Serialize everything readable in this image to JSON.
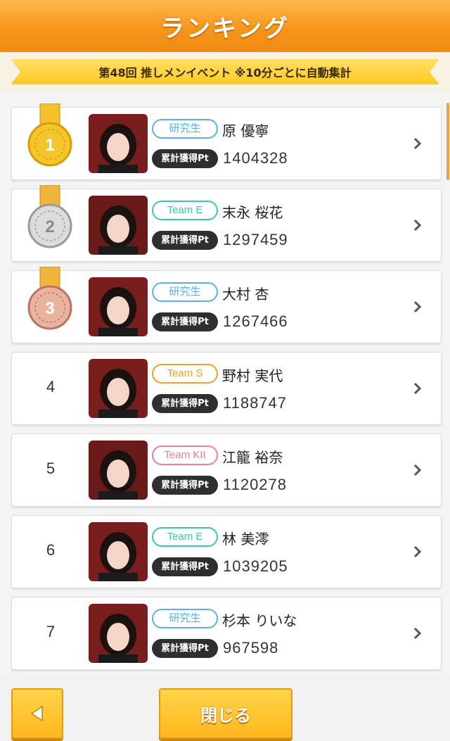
{
  "header": {
    "title": "ランキング"
  },
  "banner": {
    "text": "第48回 推しメンイベント ※10分ごとに自動集計"
  },
  "pt_label": "累計獲得Pt",
  "rankings": [
    {
      "rank": "1",
      "medal": "gold",
      "team": "研究生",
      "team_color": "#5bb0e6",
      "name": "原 優寧",
      "points": "1404328",
      "photo_bg": "#7a1d1d"
    },
    {
      "rank": "2",
      "medal": "silver",
      "team": "Team E",
      "team_color": "#3cc6b4",
      "name": "末永 桜花",
      "points": "1297459",
      "photo_bg": "#6b1a1a"
    },
    {
      "rank": "3",
      "medal": "bronze",
      "team": "研究生",
      "team_color": "#5bb0e6",
      "name": "大村 杏",
      "points": "1267466",
      "photo_bg": "#7a1d1d"
    },
    {
      "rank": "4",
      "medal": "",
      "team": "Team S",
      "team_color": "#f0a02a",
      "name": "野村 実代",
      "points": "1188747",
      "photo_bg": "#7a1d1d"
    },
    {
      "rank": "5",
      "medal": "",
      "team": "Team KII",
      "team_color": "#ef7f90",
      "name": "江籠 裕奈",
      "points": "1120278",
      "photo_bg": "#6b1a1a"
    },
    {
      "rank": "6",
      "medal": "",
      "team": "Team E",
      "team_color": "#3cc6b4",
      "name": "林 美澪",
      "points": "1039205",
      "photo_bg": "#7a1d1d"
    },
    {
      "rank": "7",
      "medal": "",
      "team": "研究生",
      "team_color": "#5bb0e6",
      "name": "杉本 りいな",
      "points": "967598",
      "photo_bg": "#7a1d1d"
    }
  ],
  "footer": {
    "back_icon": "triangle-left-icon",
    "close_label": "閉じる"
  }
}
